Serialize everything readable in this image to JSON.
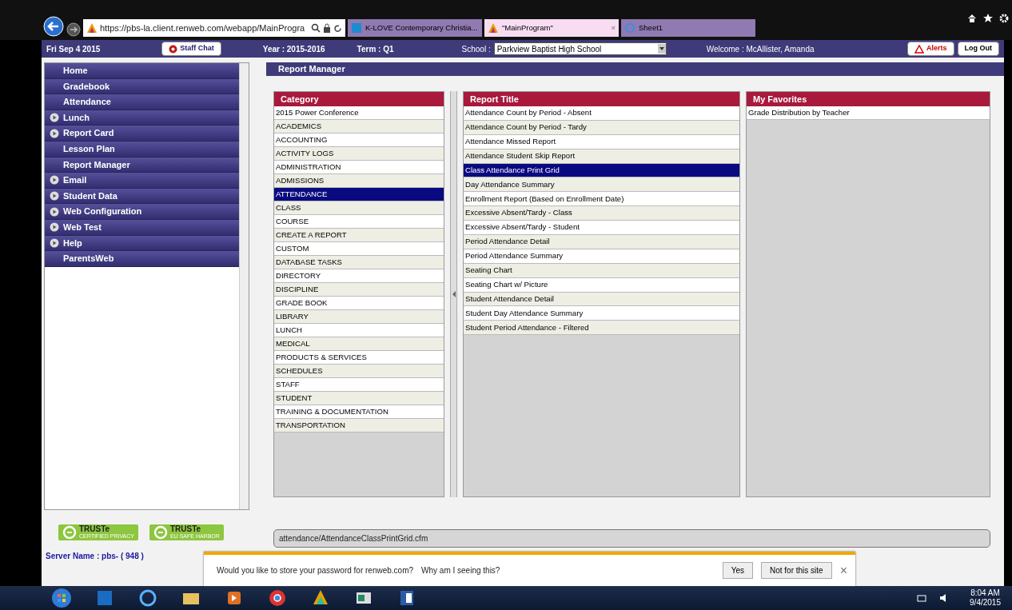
{
  "browser": {
    "address": "https://pbs-la.client.renweb.com/webapp/MainProgra",
    "tabs": [
      {
        "label": "K-LOVE Contemporary Christia...",
        "selected": false,
        "kind": "k"
      },
      {
        "label": "\"MainProgram\"",
        "selected": true,
        "kind": "app",
        "close": "×"
      },
      {
        "label": "Sheet1",
        "selected": false,
        "kind": "ie"
      }
    ]
  },
  "header": {
    "date": "Fri Sep 4 2015",
    "staff_chat": "Staff Chat",
    "year": "Year : 2015-2016",
    "term": "Term : Q1",
    "school_label": "School :",
    "school": "Parkview Baptist High School",
    "welcome": "Welcome : McAllister, Amanda",
    "alerts": "Alerts",
    "logout": "Log Out"
  },
  "sidebar": {
    "items": [
      {
        "label": "Home",
        "kind": "link"
      },
      {
        "label": "Gradebook",
        "kind": "link"
      },
      {
        "label": "Attendance",
        "kind": "link"
      },
      {
        "label": "Lunch",
        "kind": "menu"
      },
      {
        "label": "Report Card",
        "kind": "menu"
      },
      {
        "label": "Lesson Plan",
        "kind": "link"
      },
      {
        "label": "Report Manager",
        "kind": "link"
      },
      {
        "label": "Email",
        "kind": "menu"
      },
      {
        "label": "Student Data",
        "kind": "menu"
      },
      {
        "label": "Web Configuration",
        "kind": "menu"
      },
      {
        "label": "Web Test",
        "kind": "menu"
      },
      {
        "label": "Help",
        "kind": "menu"
      },
      {
        "label": "ParentsWeb",
        "kind": "link"
      }
    ]
  },
  "badges": [
    {
      "name": "TRUSTe",
      "sub": "CERTIFIED PRIVACY"
    },
    {
      "name": "TRUSTe",
      "sub": "EU SAFE HARBOR"
    }
  ],
  "server": "Server Name : pbs- ( 948 )",
  "title": "Report Manager",
  "category": {
    "heading": "Category",
    "items": [
      {
        "label": "2015 Power Conference",
        "selected": false
      },
      {
        "label": "ACADEMICS",
        "selected": false
      },
      {
        "label": "ACCOUNTING",
        "selected": false
      },
      {
        "label": "ACTIVITY LOGS",
        "selected": false
      },
      {
        "label": "ADMINISTRATION",
        "selected": false
      },
      {
        "label": "ADMISSIONS",
        "selected": false
      },
      {
        "label": "ATTENDANCE",
        "selected": true
      },
      {
        "label": "CLASS",
        "selected": false
      },
      {
        "label": "COURSE",
        "selected": false
      },
      {
        "label": "CREATE A REPORT",
        "selected": false
      },
      {
        "label": "CUSTOM",
        "selected": false
      },
      {
        "label": "DATABASE TASKS",
        "selected": false
      },
      {
        "label": "DIRECTORY",
        "selected": false
      },
      {
        "label": "DISCIPLINE",
        "selected": false
      },
      {
        "label": "GRADE BOOK",
        "selected": false
      },
      {
        "label": "LIBRARY",
        "selected": false
      },
      {
        "label": "LUNCH",
        "selected": false
      },
      {
        "label": "MEDICAL",
        "selected": false
      },
      {
        "label": "PRODUCTS & SERVICES",
        "selected": false
      },
      {
        "label": "SCHEDULES",
        "selected": false
      },
      {
        "label": "STAFF",
        "selected": false
      },
      {
        "label": "STUDENT",
        "selected": false
      },
      {
        "label": "TRAINING & DOCUMENTATION",
        "selected": false
      },
      {
        "label": "TRANSPORTATION",
        "selected": false
      }
    ]
  },
  "reports": {
    "heading": "Report Title",
    "items": [
      {
        "label": "Attendance Count by Period - Absent",
        "selected": false
      },
      {
        "label": "Attendance Count by Period - Tardy",
        "selected": false
      },
      {
        "label": "Attendance Missed Report",
        "selected": false
      },
      {
        "label": "Attendance Student Skip Report",
        "selected": false
      },
      {
        "label": "Class Attendance Print Grid",
        "selected": true
      },
      {
        "label": "Day Attendance Summary",
        "selected": false
      },
      {
        "label": "Enrollment Report (Based on Enrollment Date)",
        "selected": false
      },
      {
        "label": "Excessive Absent/Tardy - Class",
        "selected": false
      },
      {
        "label": "Excessive Absent/Tardy - Student",
        "selected": false
      },
      {
        "label": "Period Attendance Detail",
        "selected": false
      },
      {
        "label": "Period Attendance Summary",
        "selected": false
      },
      {
        "label": "Seating Chart",
        "selected": false
      },
      {
        "label": "Seating Chart w/ Picture",
        "selected": false
      },
      {
        "label": "Student Attendance Detail",
        "selected": false
      },
      {
        "label": "Student Day Attendance Summary",
        "selected": false
      },
      {
        "label": "Student Period Attendance - Filtered",
        "selected": false
      }
    ]
  },
  "favorites": {
    "heading": "My Favorites",
    "items": [
      {
        "label": "Grade Distribution by Teacher",
        "selected": false
      }
    ]
  },
  "path": "attendance/AttendanceClassPrintGrid.cfm",
  "password_bar": {
    "question": "Would you like to store your password for renweb.com?",
    "link": "Why am I seeing this?",
    "buttons": [
      "Yes",
      "Not for this site"
    ],
    "close": "×"
  },
  "taskbar": {
    "time": "8:04 AM",
    "date": "9/4/2015"
  }
}
